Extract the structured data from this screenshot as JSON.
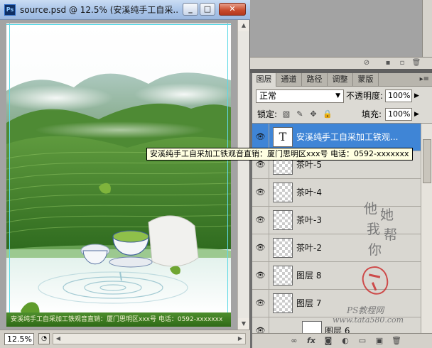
{
  "document_window": {
    "app_icon": "Ps",
    "title": "source.psd @ 12.5% (安溪纯手工自采...",
    "zoom": "12.5%",
    "footer_text": "安溪纯手工自采加工铁观音直销：厦门思明区xxx号   电话：0592-xxxxxxx",
    "icons": {
      "minimize": "minimize-icon",
      "maximize": "maximize-icon",
      "close": "close-icon"
    }
  },
  "layers_panel": {
    "tabs": [
      {
        "label": "图层",
        "active": true
      },
      {
        "label": "通道",
        "active": false
      },
      {
        "label": "路径",
        "active": false
      },
      {
        "label": "调整",
        "active": false
      },
      {
        "label": "蒙版",
        "active": false
      }
    ],
    "blend_mode": "正常",
    "opacity_label": "不透明度:",
    "opacity_value": "100%",
    "lock_label": "锁定:",
    "fill_label": "填充:",
    "fill_value": "100%",
    "layers": [
      {
        "name": "安溪纯手工自采加工铁观...",
        "type": "text",
        "thumb": "T",
        "visible": true,
        "selected": true
      },
      {
        "name": "茶叶-5",
        "type": "raster",
        "visible": true,
        "selected": false
      },
      {
        "name": "茶叶-4",
        "type": "raster",
        "visible": true,
        "selected": false
      },
      {
        "name": "茶叶-3",
        "type": "raster",
        "visible": true,
        "selected": false
      },
      {
        "name": "茶叶-2",
        "type": "raster",
        "visible": true,
        "selected": false
      },
      {
        "name": "图层 8",
        "type": "raster",
        "visible": true,
        "selected": false
      },
      {
        "name": "图层 7",
        "type": "raster",
        "visible": true,
        "selected": false
      },
      {
        "name": "图层 6",
        "type": "raster",
        "visible": true,
        "selected": false
      }
    ]
  },
  "tooltip": "安溪纯手工自采加工铁观音直销：厦门思明区xxx号   电话：0592-xxxxxxx",
  "watermark": {
    "calligraphy": [
      "他",
      "她",
      "我",
      "帮",
      "你"
    ],
    "line1": "PS教程网",
    "line2": "www.tata580.com"
  },
  "colors": {
    "selection": "#3f85d6",
    "footer_green": "#3d7c22",
    "tooltip_bg": "#ffffe1"
  }
}
